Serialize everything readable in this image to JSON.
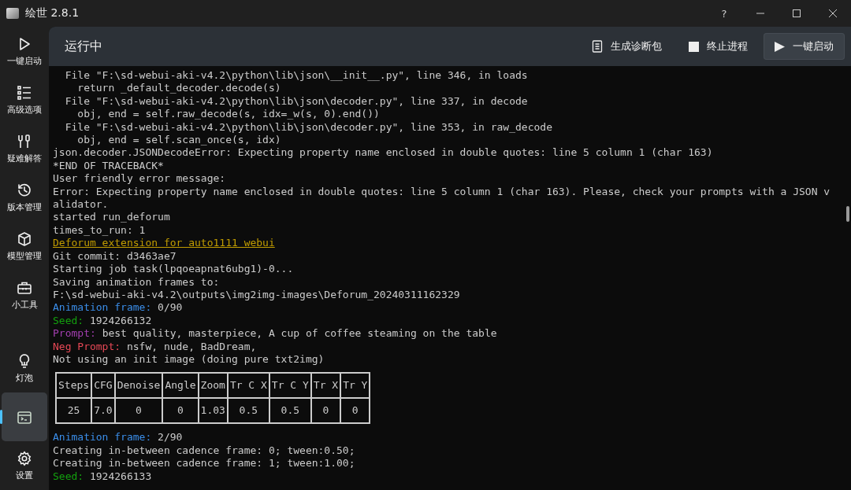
{
  "window": {
    "title": "绘世 2.8.1",
    "controls": [
      "?"
    ]
  },
  "sidebar": {
    "items": [
      {
        "label": "一键启动",
        "selected": false
      },
      {
        "label": "高级选项",
        "selected": false
      },
      {
        "label": "疑难解答",
        "selected": false
      },
      {
        "label": "版本管理",
        "selected": false
      },
      {
        "label": "模型管理",
        "selected": false
      },
      {
        "label": "小工具",
        "selected": false
      }
    ],
    "bottom_items": [
      {
        "label": "灯泡",
        "selected": false
      },
      {
        "selected": true
      },
      {
        "label": "设置",
        "selected": false
      }
    ]
  },
  "header": {
    "title": "运行中",
    "actions": [
      {
        "label": "生成诊断包",
        "primary": false
      },
      {
        "label": "终止进程",
        "primary": false
      },
      {
        "label": "一键启动",
        "primary": true
      }
    ]
  },
  "console": {
    "lines": [
      {
        "kind": "text",
        "text": "  File \"F:\\sd-webui-aki-v4.2\\python\\lib\\json\\__init__.py\", line 346, in loads"
      },
      {
        "kind": "text",
        "text": "    return _default_decoder.decode(s)"
      },
      {
        "kind": "text",
        "text": "  File \"F:\\sd-webui-aki-v4.2\\python\\lib\\json\\decoder.py\", line 337, in decode"
      },
      {
        "kind": "text",
        "text": "    obj, end = self.raw_decode(s, idx=_w(s, 0).end())"
      },
      {
        "kind": "text",
        "text": "  File \"F:\\sd-webui-aki-v4.2\\python\\lib\\json\\decoder.py\", line 353, in raw_decode"
      },
      {
        "kind": "text",
        "text": "    obj, end = self.scan_once(s, idx)"
      },
      {
        "kind": "text",
        "text": "json.decoder.JSONDecodeError: Expecting property name enclosed in double quotes: line 5 column 1 (char 163)"
      },
      {
        "kind": "text",
        "text": "*END OF TRACEBACK*"
      },
      {
        "kind": "text",
        "text": "User friendly error message:"
      },
      {
        "kind": "text",
        "text": "Error: Expecting property name enclosed in double quotes: line 5 column 1 (char 163). Please, check your prompts with a JSON v"
      },
      {
        "kind": "text",
        "text": "alidator."
      },
      {
        "kind": "text",
        "text": "started run_deforum"
      },
      {
        "kind": "text",
        "text": "times_to_run: 1"
      },
      {
        "kind": "link",
        "text": "Deforum extension for auto1111 webui"
      },
      {
        "kind": "text",
        "text": "Git commit: d3463ae7"
      },
      {
        "kind": "text",
        "text": "Starting job task(lpqoeapnat6ubg1)-0..."
      },
      {
        "kind": "text",
        "text": "Saving animation frames to:"
      },
      {
        "kind": "text",
        "text": "F:\\sd-webui-aki-v4.2\\outputs\\img2img-images\\Deforum_20240311162329"
      },
      {
        "kind": "field",
        "label": "Animation frame:",
        "color": "#3b8eea",
        "text": "0/90"
      },
      {
        "kind": "field",
        "label": "Seed:",
        "color": "#13a10e",
        "text": "1924266132"
      },
      {
        "kind": "field",
        "label": "Prompt:",
        "color": "#a33fb0",
        "text": "best quality, masterpiece, A cup of coffee steaming on the table"
      },
      {
        "kind": "field",
        "label": "Neg Prompt:",
        "color": "#e74856",
        "text": "nsfw, nude, BadDream,"
      },
      {
        "kind": "text",
        "text": "Not using an init image (doing pure txt2img)"
      },
      {
        "kind": "table",
        "columns": [
          "Steps",
          "CFG",
          "Denoise",
          "Angle",
          "Zoom",
          "Tr C X",
          "Tr C Y",
          "Tr X",
          "Tr Y"
        ],
        "rows": [
          [
            "25",
            "7.0",
            "0",
            "0",
            "1.03",
            "0.5",
            "0.5",
            "0",
            "0"
          ]
        ]
      },
      {
        "kind": "field",
        "label": "Animation frame:",
        "color": "#3b8eea",
        "text": "2/90"
      },
      {
        "kind": "text",
        "text": "Creating in-between cadence frame: 0; tween:0.50;"
      },
      {
        "kind": "text",
        "text": "Creating in-between cadence frame: 1; tween:1.00;"
      },
      {
        "kind": "field",
        "label": "Seed:",
        "color": "#13a10e",
        "text": "1924266133"
      }
    ]
  }
}
